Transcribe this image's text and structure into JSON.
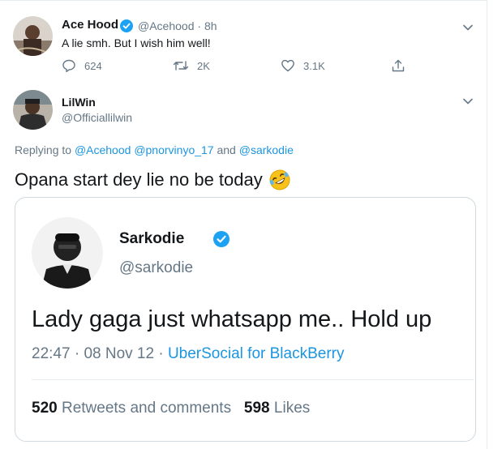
{
  "tweet1": {
    "name": "Ace Hood",
    "handle": "@Acehood",
    "separator": "·",
    "time": "8h",
    "text": "A lie smh. But I wish him well!",
    "reply_count": "624",
    "retweet_count": "2K",
    "like_count": "3.1K"
  },
  "tweet2": {
    "name": "LilWin",
    "handle": "@Officiallilwin",
    "replying_prefix": "Replying to",
    "mention1": "@Acehood",
    "mention2": "@pnorvinyo_17",
    "and_word": "and",
    "mention3": "@sarkodie",
    "text": "Opana start dey lie no be today"
  },
  "quoted": {
    "name": "Sarkodie",
    "handle": "@sarkodie",
    "text": "Lady gaga just whatsapp me.. Hold up",
    "time": "22:47",
    "date": "08 Nov 12",
    "dot": "·",
    "source": "UberSocial for BlackBerry",
    "retweets_count": "520",
    "retweets_label": "Retweets and comments",
    "likes_count": "598",
    "likes_label": "Likes"
  },
  "colors": {
    "accent": "#1da1f2",
    "link": "#1b95e0",
    "secondary_text": "#657786"
  },
  "icons": [
    "verified-badge-icon",
    "chevron-down-icon",
    "reply-icon",
    "retweet-icon",
    "like-icon",
    "share-icon",
    "rolling-laughing-emoji"
  ]
}
